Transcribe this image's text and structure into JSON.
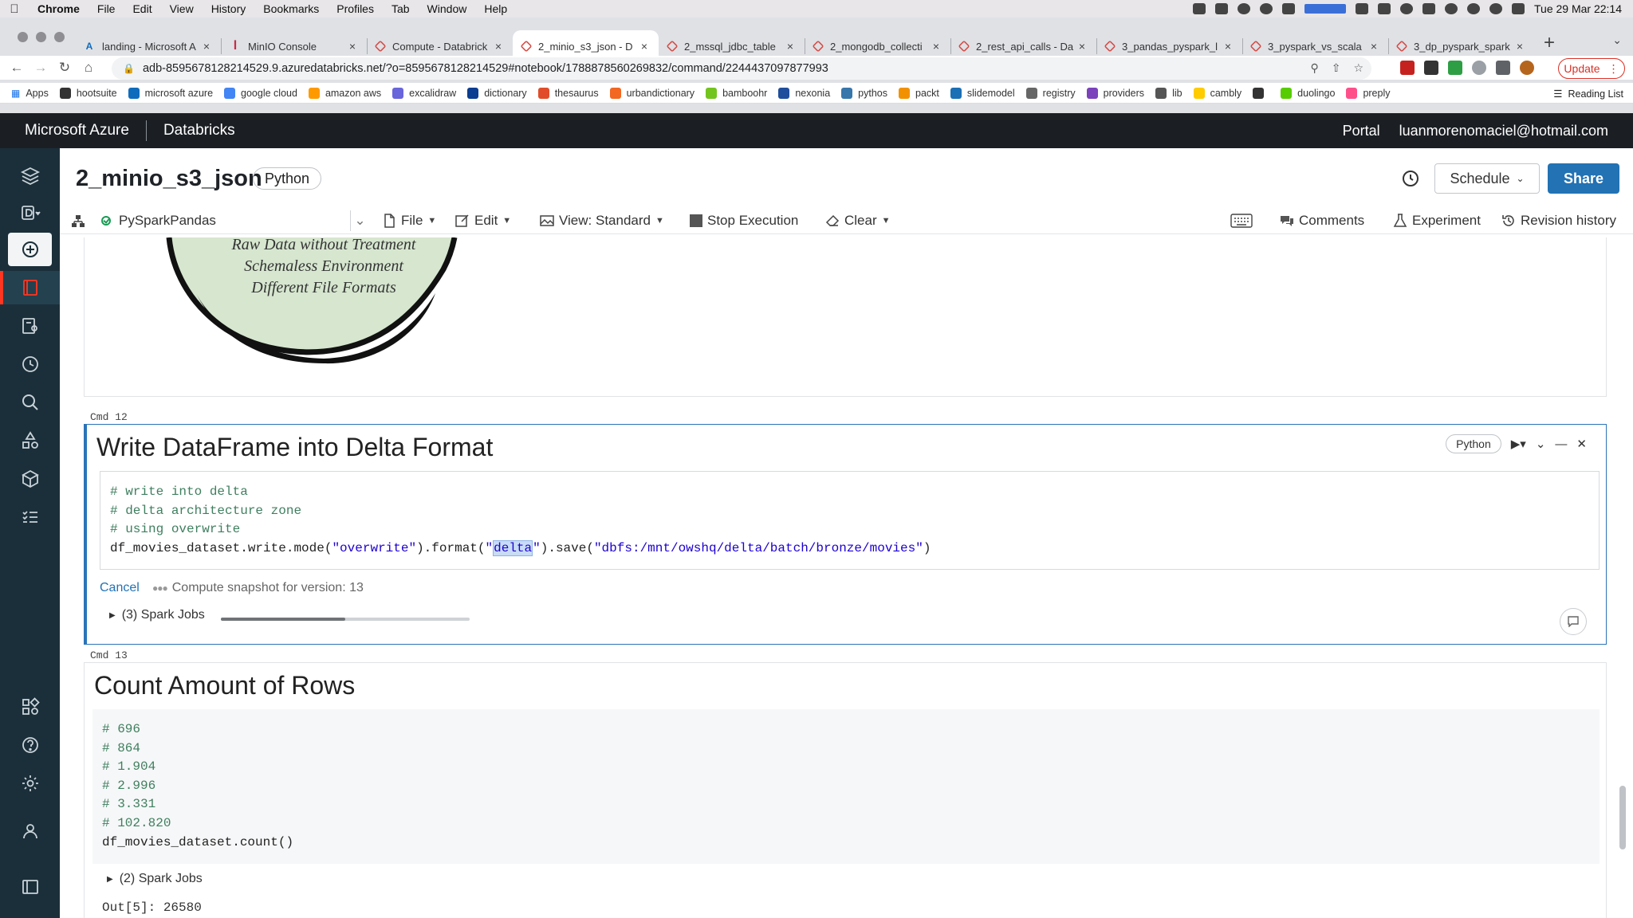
{
  "mac_menu": {
    "app": "Chrome",
    "items": [
      "File",
      "Edit",
      "View",
      "History",
      "Bookmarks",
      "Profiles",
      "Tab",
      "Window",
      "Help"
    ],
    "clock": "Tue 29 Mar  22:14"
  },
  "tabs": [
    {
      "label": "landing - Microsoft A",
      "icon": "azure-icon",
      "active": false
    },
    {
      "label": "MinIO Console",
      "icon": "minio-icon",
      "active": false
    },
    {
      "label": "Compute - Databrick",
      "icon": "databricks-icon",
      "active": false
    },
    {
      "label": "2_minio_s3_json - D",
      "icon": "databricks-icon",
      "active": true
    },
    {
      "label": "2_mssql_jdbc_table",
      "icon": "databricks-icon",
      "active": false
    },
    {
      "label": "2_mongodb_collecti",
      "icon": "databricks-icon",
      "active": false
    },
    {
      "label": "2_rest_api_calls - Da",
      "icon": "databricks-icon",
      "active": false
    },
    {
      "label": "3_pandas_pyspark_l",
      "icon": "databricks-icon",
      "active": false
    },
    {
      "label": "3_pyspark_vs_scala",
      "icon": "databricks-icon",
      "active": false
    },
    {
      "label": "3_dp_pyspark_spark",
      "icon": "databricks-icon",
      "active": false
    }
  ],
  "address_bar": {
    "url": "adb-8595678128214529.9.azuredatabricks.net/?o=8595678128214529#notebook/1788878560269832/command/2244437097877993"
  },
  "update_button": "Update",
  "bookmarks": {
    "apps": "Apps",
    "items": [
      {
        "label": "hootsuite",
        "color": "#333333"
      },
      {
        "label": "microsoft azure",
        "color": "#0f6cbd"
      },
      {
        "label": "google cloud",
        "color": "#4285f4"
      },
      {
        "label": "amazon aws",
        "color": "#ff9900"
      },
      {
        "label": "excalidraw",
        "color": "#6965db"
      },
      {
        "label": "dictionary",
        "color": "#0b3d91"
      },
      {
        "label": "thesaurus",
        "color": "#e14d2a"
      },
      {
        "label": "urbandictionary",
        "color": "#f26722"
      },
      {
        "label": "bamboohr",
        "color": "#73c41d"
      },
      {
        "label": "nexonia",
        "color": "#1f4e9c"
      },
      {
        "label": "pythos",
        "color": "#3776ab"
      },
      {
        "label": "packt",
        "color": "#f29100"
      },
      {
        "label": "slidemodel",
        "color": "#1a6fb5"
      },
      {
        "label": "registry",
        "color": "#666666"
      },
      {
        "label": "providers",
        "color": "#7b42bc"
      },
      {
        "label": "lib",
        "color": "#555555"
      },
      {
        "label": "cambly",
        "color": "#ffcc00"
      },
      {
        "label": "",
        "color": "#333333"
      },
      {
        "label": "duolingo",
        "color": "#58cc02"
      },
      {
        "label": "preply",
        "color": "#ff4f8b"
      }
    ],
    "reading_list": "Reading List"
  },
  "db_header": {
    "brand": "Microsoft Azure",
    "product": "Databricks",
    "portal": "Portal",
    "user": "luanmorenomaciel@hotmail.com"
  },
  "notebook": {
    "title": "2_minio_s3_json",
    "language": "Python",
    "schedule": "Schedule",
    "share": "Share",
    "cluster": "PySparkPandas",
    "menu": {
      "file": "File",
      "edit": "Edit",
      "view": "View: Standard",
      "stop": "Stop Execution",
      "clear": "Clear"
    },
    "right_menu": {
      "comments": "Comments",
      "experiment": "Experiment",
      "revision": "Revision history"
    }
  },
  "image_cell": {
    "lines": [
      "Raw Data without Treatment",
      "Schemaless Environment",
      "Different File Formats"
    ]
  },
  "cell12": {
    "cmd": "Cmd  12",
    "title": "Write DataFrame into Delta Format",
    "language": "Python",
    "code": {
      "c1": "# write into delta",
      "c2": "# delta architecture zone",
      "c3": "# using overwrite",
      "p1": "df_movies_dataset.write.mode(",
      "s1": "\"overwrite\"",
      "p2": ").format(",
      "q1": "\"",
      "s2": "delta",
      "q2": "\"",
      "p3": ").save(",
      "s3": "\"dbfs:/mnt/owshq/delta/batch/bronze/movies\"",
      "p4": ")"
    },
    "cancel": "Cancel",
    "snapshot": "Compute snapshot for version: 13",
    "spark_jobs": "(3) Spark Jobs",
    "progress": 0.5
  },
  "cell13": {
    "cmd": "Cmd  13",
    "title": "Count Amount of Rows",
    "code_lines": [
      "# 696",
      "# 864",
      "# 1.904",
      "# 2.996",
      "# 3.331",
      "# 102.820"
    ],
    "code_last": "df_movies_dataset.count()",
    "spark_jobs": "(2) Spark Jobs",
    "output": "Out[5]: 26580"
  }
}
